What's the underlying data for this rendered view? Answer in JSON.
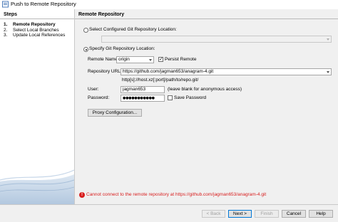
{
  "window": {
    "title": "Push to Remote Repository"
  },
  "steps": {
    "heading": "Steps",
    "items": [
      {
        "num": "1.",
        "label": "Remote Repository"
      },
      {
        "num": "2.",
        "label": "Select Local Branches"
      },
      {
        "num": "3.",
        "label": "Update Local References"
      }
    ]
  },
  "panel": {
    "heading": "Remote Repository",
    "option_configured": "Select Configured Git Repository Location:",
    "option_specify": "Specify Git Repository Location:",
    "remote_name_label": "Remote Name:",
    "remote_name_value": "origin",
    "persist_remote_label": "Persist Remote",
    "repository_url_label": "Repository URL:",
    "repository_url_value": "https://github.com/jagman653/anagram-4.git",
    "url_hint": "http[s]://host.xz[:port]/path/to/repo.git/",
    "user_label": "User:",
    "user_value": "jagman653",
    "user_hint": "(leave blank for anonymous access)",
    "password_label": "Password:",
    "password_value": "●●●●●●●●●●●",
    "save_password_label": "Save Password",
    "proxy_button": "Proxy Configuration..."
  },
  "error": {
    "icon": "!",
    "message": "Cannot connect to the remote repository at https://github.com/jagman653/anagram-4.git"
  },
  "buttons": {
    "back": "< Back",
    "next": "Next >",
    "finish": "Finish",
    "cancel": "Cancel",
    "help": "Help"
  },
  "colors": {
    "error": "#d81e1e",
    "default_button_border": "#0078d7",
    "panel_bg": "#f0f0f0"
  }
}
